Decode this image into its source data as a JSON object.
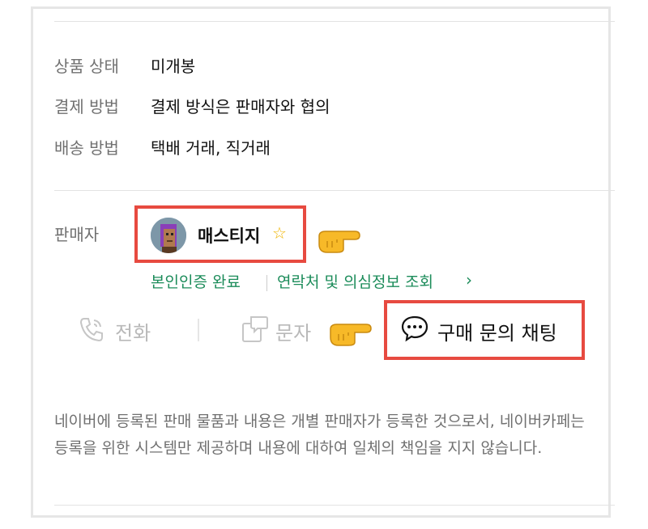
{
  "product_info": [
    {
      "label": "상품 상태",
      "value": "미개봉"
    },
    {
      "label": "결제 방법",
      "value": "결제 방식은 판매자와 협의"
    },
    {
      "label": "배송 방법",
      "value": "택배 거래, 직거래"
    }
  ],
  "seller": {
    "label": "판매자",
    "name": "매스티지",
    "star": "☆",
    "verification": "본인인증 완료",
    "contact_link": "연락처 및 의심정보 조회",
    "contact_chevron": "›"
  },
  "actions": {
    "call_label": "전화",
    "sms_label": "문자",
    "chat_label": "구매 문의 채팅"
  },
  "notice": "네이버에 등록된 판매 물품과 내용은 개별 판매자가 등록한 것으로서, 네이버카페는 등록을 위한 시스템만 제공하며 내용에 대하여 일체의 책임을 지지 않습니다.",
  "colors": {
    "highlight": "#e74a40",
    "link": "#1c8c5a",
    "muted": "#707070"
  },
  "icons": [
    "phone-icon",
    "message-icon",
    "chat-bubble-icon",
    "pointing-hand-icon",
    "star-icon"
  ]
}
